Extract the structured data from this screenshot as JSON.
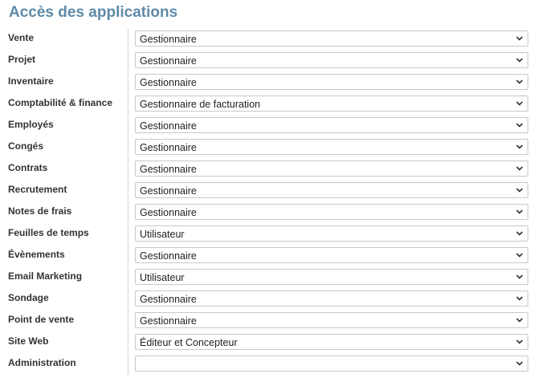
{
  "section": {
    "title": "Accès des applications"
  },
  "rows": [
    {
      "label": "Vente",
      "value": "Gestionnaire"
    },
    {
      "label": "Projet",
      "value": "Gestionnaire"
    },
    {
      "label": "Inventaire",
      "value": "Gestionnaire"
    },
    {
      "label": "Comptabilité & finance",
      "value": "Gestionnaire de facturation"
    },
    {
      "label": "Employés",
      "value": "Gestionnaire"
    },
    {
      "label": "Congés",
      "value": "Gestionnaire"
    },
    {
      "label": "Contrats",
      "value": "Gestionnaire"
    },
    {
      "label": "Recrutement",
      "value": "Gestionnaire"
    },
    {
      "label": "Notes de frais",
      "value": "Gestionnaire"
    },
    {
      "label": "Feuilles de temps",
      "value": "Utilisateur"
    },
    {
      "label": "Évènements",
      "value": "Gestionnaire"
    },
    {
      "label": "Email Marketing",
      "value": "Utilisateur"
    },
    {
      "label": "Sondage",
      "value": "Gestionnaire"
    },
    {
      "label": "Point de vente",
      "value": "Gestionnaire"
    },
    {
      "label": "Site Web",
      "value": "Éditeur et Concepteur"
    },
    {
      "label": "Administration",
      "value": ""
    }
  ],
  "icons": {
    "dropdown": "chevron-down-icon"
  }
}
